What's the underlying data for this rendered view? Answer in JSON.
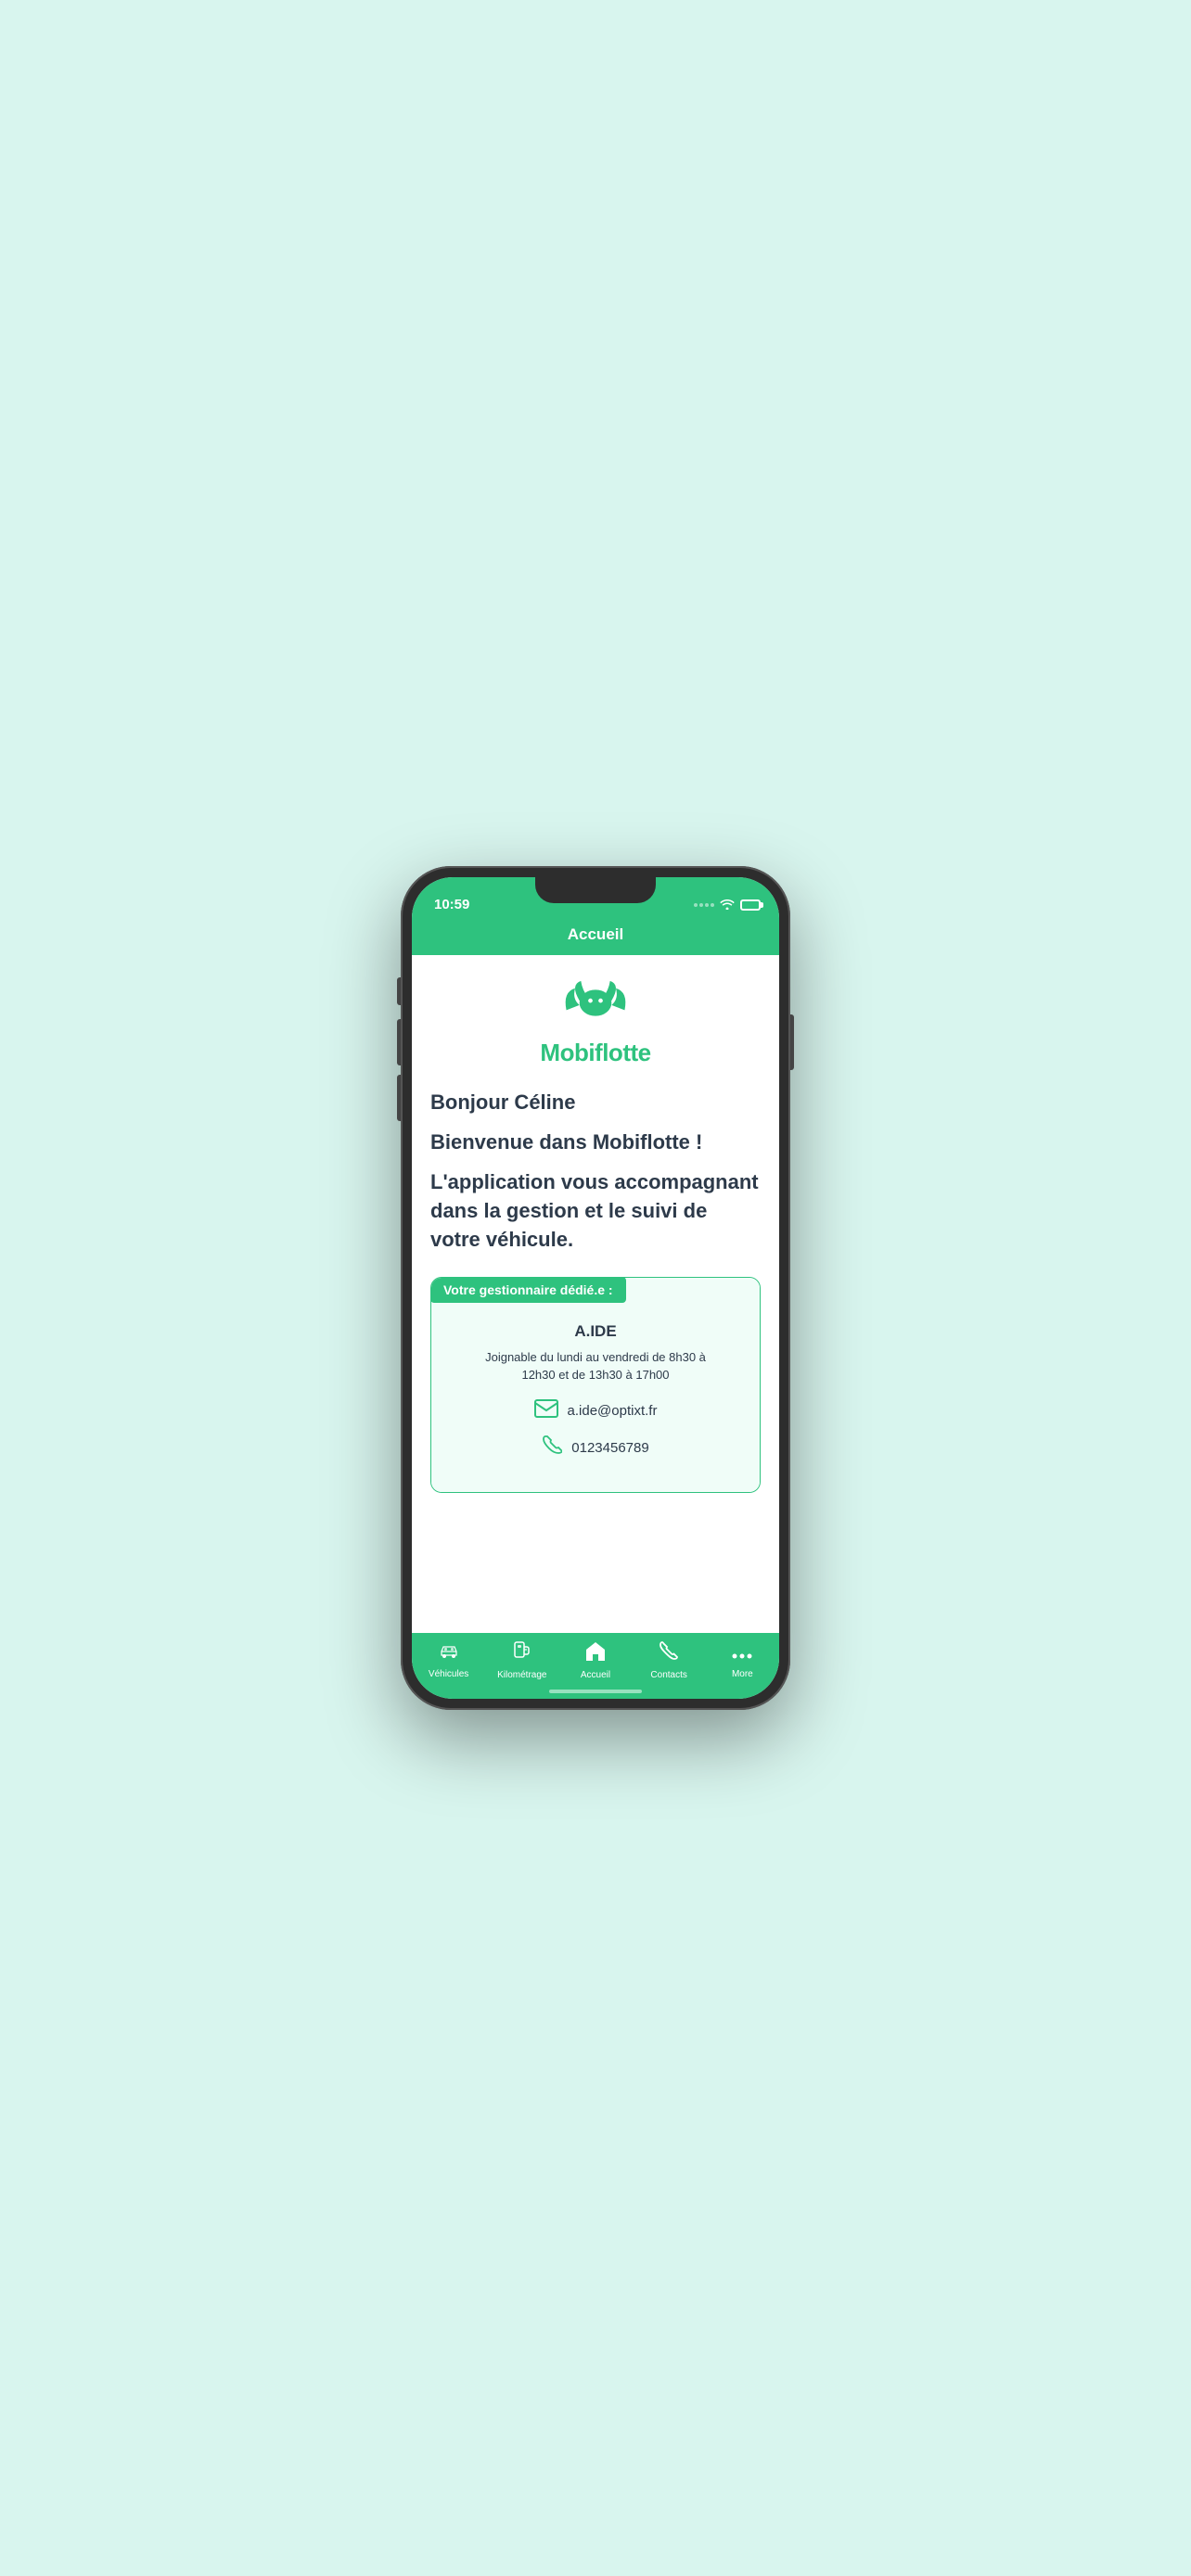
{
  "status": {
    "time": "10:59"
  },
  "header": {
    "title": "Accueil"
  },
  "main": {
    "logo_text": "Mobiflotte",
    "greeting": "Bonjour Céline",
    "welcome": "Bienvenue dans Mobiflotte !",
    "description": "L'application vous accompagnant dans la gestion et le suivi de votre véhicule.",
    "manager_badge": "Votre gestionnaire dédié.e :",
    "manager_name": "A.IDE",
    "manager_hours": "Joignable du lundi au vendredi de 8h30 à\n12h30 et de 13h30 à 17h00",
    "manager_email": "a.ide@optixt.fr",
    "manager_phone": "0123456789"
  },
  "tabs": [
    {
      "id": "vehicules",
      "label": "Véhicules",
      "icon": "car"
    },
    {
      "id": "kilometrage",
      "label": "Kilométrage",
      "icon": "fuel"
    },
    {
      "id": "accueil",
      "label": "Accueil",
      "icon": "home",
      "active": true
    },
    {
      "id": "contacts",
      "label": "Contacts",
      "icon": "phone"
    },
    {
      "id": "more",
      "label": "More",
      "icon": "dots"
    }
  ],
  "colors": {
    "primary": "#2ec27e",
    "text_dark": "#2d3a4a"
  }
}
